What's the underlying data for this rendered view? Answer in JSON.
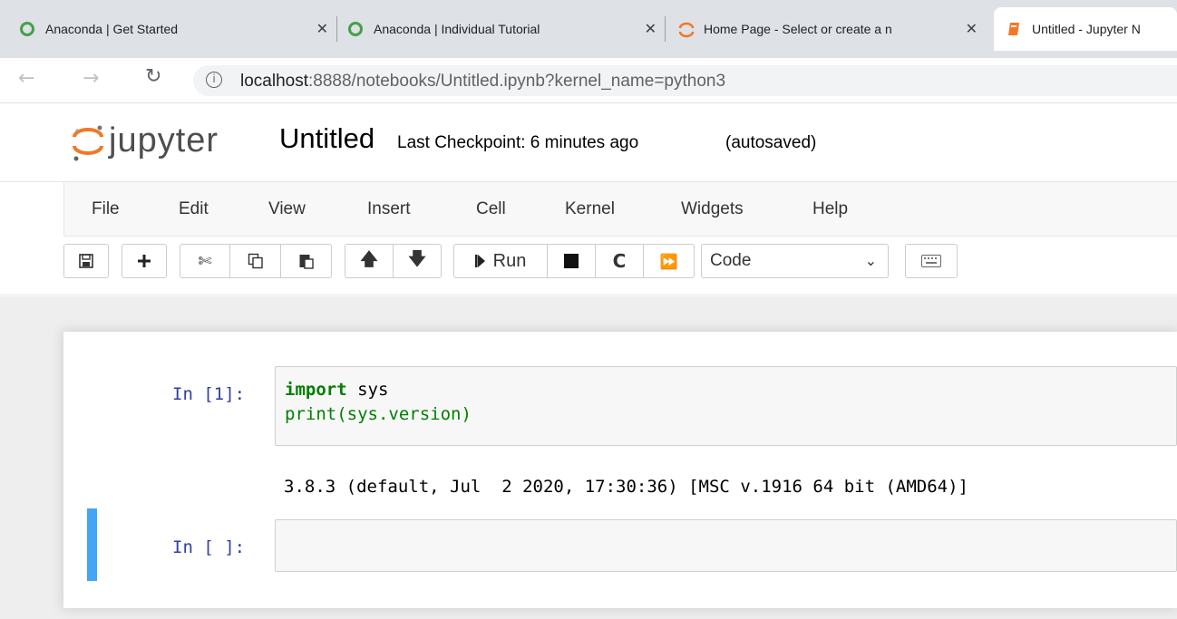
{
  "browser": {
    "tabs": [
      {
        "title": "Anaconda | Get Started",
        "close": "✕"
      },
      {
        "title": "Anaconda | Individual Tutorial",
        "close": "✕"
      },
      {
        "title": "Home Page - Select or create a n",
        "close": "✕"
      },
      {
        "title": "Untitled - Jupyter N"
      }
    ],
    "url_host": "localhost",
    "url_rest": ":8888/notebooks/Untitled.ipynb?kernel_name=python3",
    "info_glyph": "i",
    "back_glyph": "←",
    "forward_glyph": "→",
    "reload_glyph": "↻"
  },
  "jupyter": {
    "logo_text": "jupyter",
    "notebook_title": "Untitled",
    "checkpoint": "Last Checkpoint: 6 minutes ago",
    "autosave": "(autosaved)"
  },
  "menubar": {
    "items": [
      "File",
      "Edit",
      "View",
      "Insert",
      "Cell",
      "Kernel",
      "Widgets",
      "Help"
    ]
  },
  "toolbar": {
    "run_label": "Run",
    "cell_type": "Code",
    "cell_type_options": [
      "Code"
    ]
  },
  "cells": [
    {
      "prompt": "In [1]:",
      "code_kw": "import",
      "code_line1_rest": " sys",
      "code_line2": "print(sys.version)",
      "output": "3.8.3 (default, Jul  2 2020, 17:30:36) [MSC v.1916 64 bit (AMD64)]"
    },
    {
      "prompt": "In [ ]:",
      "code": ""
    }
  ],
  "colors": {
    "anaconda_green": "#44a047",
    "jupyter_orange": "#f37726",
    "selected_cell_bar": "#42a5f5",
    "prompt_blue": "#303f9f",
    "keyword_green": "#008000"
  }
}
